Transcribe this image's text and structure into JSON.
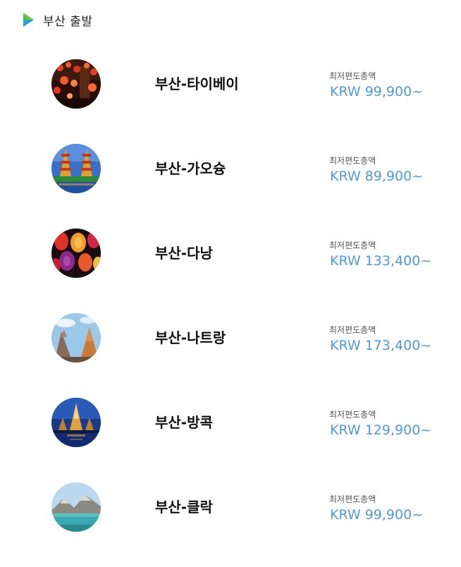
{
  "header": {
    "title": "부산 출발",
    "icon": "play-arrow-logo-icon",
    "icon_colors": [
      "#7ec13b",
      "#2a9fd6"
    ]
  },
  "routes": [
    {
      "name": "부산-타이베이",
      "fare_label": "최저편도총액",
      "fare": "KRW 99,900~",
      "thumbnail": "lanterns-street-photo"
    },
    {
      "name": "부산-가오슝",
      "fare_label": "최저편도총액",
      "fare": "KRW 89,900~",
      "thumbnail": "pagoda-towers-photo"
    },
    {
      "name": "부산-다낭",
      "fare_label": "최저편도총액",
      "fare": "KRW 133,400~",
      "thumbnail": "silk-lanterns-photo"
    },
    {
      "name": "부산-나트랑",
      "fare_label": "최저편도총액",
      "fare": "KRW 173,400~",
      "thumbnail": "cham-towers-photo"
    },
    {
      "name": "부산-방콕",
      "fare_label": "최저편도총액",
      "fare": "KRW 129,900~",
      "thumbnail": "temple-night-photo"
    },
    {
      "name": "부산-클락",
      "fare_label": "최저편도총액",
      "fare": "KRW 99,900~",
      "thumbnail": "crater-lake-photo"
    }
  ],
  "colors": {
    "price": "#4f9ad6",
    "route_name": "#111111",
    "fare_label": "#555555"
  }
}
